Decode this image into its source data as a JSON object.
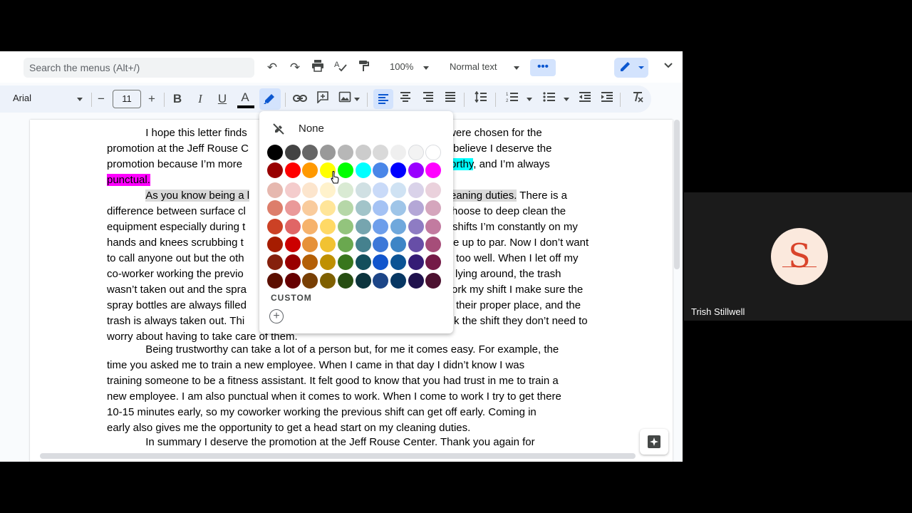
{
  "toolbar": {
    "search_placeholder": "Search the menus (Alt+/)",
    "zoom": "100%",
    "style": "Normal text",
    "more_label": "•••",
    "font": "Arial",
    "font_size": "11",
    "minus": "−",
    "plus": "+",
    "bold": "B",
    "italic": "I",
    "underline": "U",
    "text_color": "A"
  },
  "highlight_picker": {
    "none_label": "None",
    "custom_label": "CUSTOM",
    "add_custom": "+",
    "colors": [
      [
        "#000000",
        "#434343",
        "#666666",
        "#999999",
        "#b7b7b7",
        "#cccccc",
        "#d9d9d9",
        "#efefef",
        "#f3f3f3",
        "#ffffff"
      ],
      [
        "#980000",
        "#ff0000",
        "#ff9900",
        "#ffff00",
        "#00ff00",
        "#00ffff",
        "#4a86e8",
        "#0000ff",
        "#9900ff",
        "#ff00ff"
      ],
      [
        "#e6b8af",
        "#f4cccc",
        "#fce5cd",
        "#fff2cc",
        "#d9ead3",
        "#d0e0e3",
        "#c9daf8",
        "#cfe2f3",
        "#d9d2e9",
        "#ead1dc"
      ],
      [
        "#dd7e6b",
        "#ea9999",
        "#f9cb9c",
        "#ffe599",
        "#b6d7a8",
        "#a2c4c9",
        "#a4c2f4",
        "#9fc5e8",
        "#b4a7d6",
        "#d5a6bd"
      ],
      [
        "#cc4125",
        "#e06666",
        "#f6b26b",
        "#ffd966",
        "#93c47d",
        "#76a5af",
        "#6d9eeb",
        "#6fa8dc",
        "#8e7cc3",
        "#c27ba0"
      ],
      [
        "#a61c00",
        "#cc0000",
        "#e69138",
        "#f1c232",
        "#6aa84f",
        "#45818e",
        "#3c78d8",
        "#3d85c6",
        "#674ea7",
        "#a64d79"
      ],
      [
        "#85200c",
        "#990000",
        "#b45f06",
        "#bf9000",
        "#38761d",
        "#134f5c",
        "#1155cc",
        "#0b5394",
        "#351c75",
        "#741b47"
      ],
      [
        "#5b0f00",
        "#660000",
        "#783f04",
        "#7f6000",
        "#274e13",
        "#0c343d",
        "#1c4587",
        "#073763",
        "#20124d",
        "#4c1130"
      ]
    ]
  },
  "document": {
    "p1a": "I hope this letter finds",
    "p1b": "were chosen for the",
    "p1c": "promotion at the Jeff Rouse C",
    "p1d": "believe I deserve the",
    "p1e": "promotion because I’m more",
    "p1f": "orthy",
    "p1g": ", and I’m always",
    "p1h": "punctual.",
    "p2a": "As you know being a l",
    "p2b": "eaning duties.",
    "p2c": " There is a",
    "p2d": "difference between surface cl",
    "p2e": "hoose to deep clean the",
    "p2f": "equipment especially during t",
    "p2g": "shifts I’m constantly on my",
    "p2h": "hands and knees scrubbing t",
    "p2i": "e up to par. Now I don’t want",
    "p2j": "to call anyone out but the oth",
    "p2k": "too well. When I let off my",
    "p2l": "co-worker working the previo",
    "p2m": "lying around, the trash",
    "p2n": "wasn’t taken out and the spra",
    "p2o": "ork my shift I make sure the",
    "p2p": "spray bottles are always filled",
    "p2q": "their proper place, and the",
    "p2r": "trash is always taken out. Thi",
    "p2s": "k the shift they don’t need to",
    "p2t": "worry about having to take care of them.",
    "p3": [
      "Being trustworthy can take a lot of a person but, for me it comes easy. For example, the",
      "time you asked me to train a new employee. When I came in that day I didn’t know I was",
      "training someone to be a fitness assistant. It felt good to know that you had trust in me to train a",
      "new employee. I am also punctual when it comes to work. When I come to work I try to get there",
      "10-15 minutes early, so my coworker working the previous shift can get off early. Coming in",
      "early also gives me the opportunity to get a head start on my cleaning duties."
    ],
    "p4": "In summary I deserve the promotion at the Jeff Rouse Center. Thank you again for"
  },
  "participant": {
    "initial": "S",
    "name": "Trish Stillwell"
  }
}
